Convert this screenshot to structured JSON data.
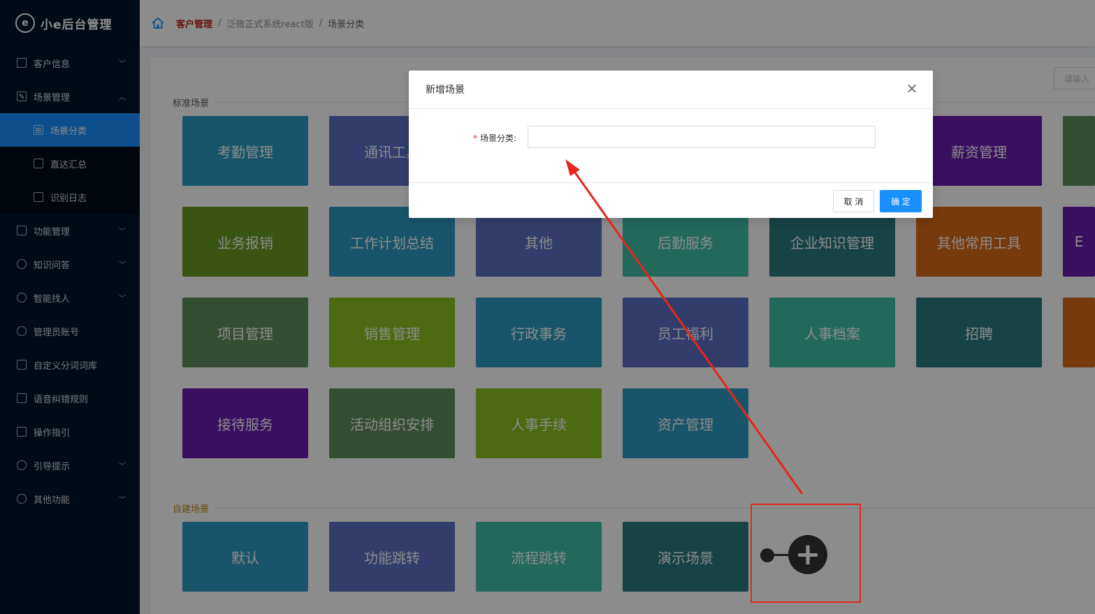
{
  "app": {
    "logo_text": "小e后台管理",
    "logo_glyph": "e"
  },
  "sidebar": {
    "items": [
      {
        "label": "客户信息",
        "icon": "file-icon",
        "expandable": true
      },
      {
        "label": "场景管理",
        "icon": "edit-icon",
        "expandable": true,
        "expanded": true
      },
      {
        "label": "功能管理",
        "icon": "file-icon",
        "expandable": true
      },
      {
        "label": "知识问答",
        "icon": "key-icon",
        "expandable": true
      },
      {
        "label": "智能找人",
        "icon": "user-icon",
        "expandable": true
      },
      {
        "label": "管理员账号",
        "icon": "users-icon",
        "expandable": false
      },
      {
        "label": "自定义分词词库",
        "icon": "book-icon",
        "expandable": false
      },
      {
        "label": "语音纠错规则",
        "icon": "file-icon",
        "expandable": false
      },
      {
        "label": "操作指引",
        "icon": "file-icon",
        "expandable": false
      },
      {
        "label": "引导提示",
        "icon": "bulb-icon",
        "expandable": true
      },
      {
        "label": "其他功能",
        "icon": "key-icon",
        "expandable": true
      }
    ],
    "submenu": [
      {
        "label": "场景分类",
        "active": true
      },
      {
        "label": "直达汇总",
        "active": false
      },
      {
        "label": "识别日志",
        "active": false
      }
    ]
  },
  "breadcrumb": {
    "items": [
      "客户管理",
      "泛微正式系统react版",
      "场景分类"
    ]
  },
  "search": {
    "placeholder": "请输入"
  },
  "sections": {
    "standard_title": "标准场景",
    "custom_title": "自建场景"
  },
  "standard_tiles": [
    {
      "label": "考勤管理",
      "color": "#2f9bc1"
    },
    {
      "label": "通讯工具",
      "color": "#5b6fc4"
    },
    {
      "label": "",
      "color": "#2f9bc1"
    },
    {
      "label": "",
      "color": "#3fbfa8"
    },
    {
      "label": "",
      "color": "#2a7b7e"
    },
    {
      "label": "薪资管理",
      "color": "#6a1db0"
    },
    {
      "label": "",
      "color": "#5d8e5e"
    },
    {
      "label": "业务报销",
      "color": "#6b9a1f"
    },
    {
      "label": "工作计划总结",
      "color": "#2f9bc1"
    },
    {
      "label": "其他",
      "color": "#5b6fc4"
    },
    {
      "label": "后勤服务",
      "color": "#3fbfa8"
    },
    {
      "label": "企业知识管理",
      "color": "#2a7b7e"
    },
    {
      "label": "其他常用工具",
      "color": "#d96a16"
    },
    {
      "label": "E",
      "color": "#6a1db0"
    },
    {
      "label": "项目管理",
      "color": "#5d8e5e"
    },
    {
      "label": "销售管理",
      "color": "#8ac21f"
    },
    {
      "label": "行政事务",
      "color": "#2f9bc1"
    },
    {
      "label": "员工福利",
      "color": "#5b6fc4"
    },
    {
      "label": "人事档案",
      "color": "#3fbfa8"
    },
    {
      "label": "招聘",
      "color": "#2a7b7e"
    },
    {
      "label": "",
      "color": "#d96a16"
    },
    {
      "label": "接待服务",
      "color": "#6a1db0"
    },
    {
      "label": "活动组织安排",
      "color": "#5d8e5e"
    },
    {
      "label": "人事手续",
      "color": "#8ac21f"
    },
    {
      "label": "资产管理",
      "color": "#2f9bc1"
    }
  ],
  "custom_tiles": [
    {
      "label": "默认",
      "color": "#2f9bc1"
    },
    {
      "label": "功能跳转",
      "color": "#5b6fc4"
    },
    {
      "label": "流程跳转",
      "color": "#3fbfa8"
    },
    {
      "label": "演示场景",
      "color": "#2a7b7e"
    }
  ],
  "add_button": {
    "icon": "plus-icon",
    "glyph": "+"
  },
  "modal": {
    "title": "新增场景",
    "close_glyph": "✕",
    "field_label": "场景分类:",
    "required_mark": "*",
    "field_value": "",
    "cancel_label": "取 消",
    "ok_label": "确 定"
  },
  "annotation": {
    "color": "#e5261c"
  }
}
